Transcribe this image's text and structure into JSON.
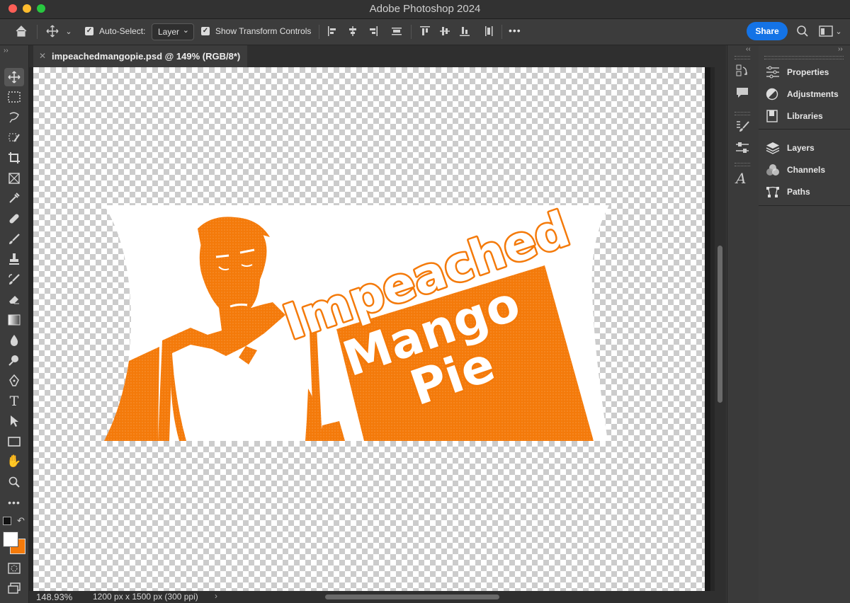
{
  "window": {
    "title": "Adobe Photoshop 2024"
  },
  "options_bar": {
    "auto_select_label": "Auto-Select:",
    "auto_select_value": "Layer",
    "show_transform_label": "Show Transform Controls",
    "more": "•••",
    "share_label": "Share"
  },
  "document": {
    "tab_title": "impeachedmangopie.psd @ 149% (RGB/8*)",
    "zoom": "148.93%",
    "dimensions": "1200 px x 1500 px (300 ppi)",
    "artwork_text": [
      "Impeached",
      "Mango",
      "Pie"
    ]
  },
  "panels": {
    "group1": [
      {
        "label": "Properties",
        "icon": "properties-icon"
      },
      {
        "label": "Adjustments",
        "icon": "adjustments-icon"
      },
      {
        "label": "Libraries",
        "icon": "libraries-icon"
      }
    ],
    "group2": [
      {
        "label": "Layers",
        "icon": "layers-icon"
      },
      {
        "label": "Channels",
        "icon": "channels-icon"
      },
      {
        "label": "Paths",
        "icon": "paths-icon"
      }
    ]
  },
  "colors": {
    "accent": "#1473e6",
    "artwork_orange": "#f47a0a",
    "background_color": "#f47a0a",
    "foreground_color": "#ffffff"
  },
  "toolbar_tools": [
    "move-tool",
    "marquee-tool",
    "lasso-tool",
    "object-selection-tool",
    "crop-tool",
    "frame-tool",
    "eyedropper-tool",
    "healing-brush-tool",
    "brush-tool",
    "clone-stamp-tool",
    "history-brush-tool",
    "eraser-tool",
    "gradient-tool",
    "blur-tool",
    "dodge-tool",
    "pen-tool",
    "type-tool",
    "path-selection-tool",
    "rectangle-tool",
    "hand-tool",
    "zoom-tool",
    "edit-toolbar"
  ]
}
